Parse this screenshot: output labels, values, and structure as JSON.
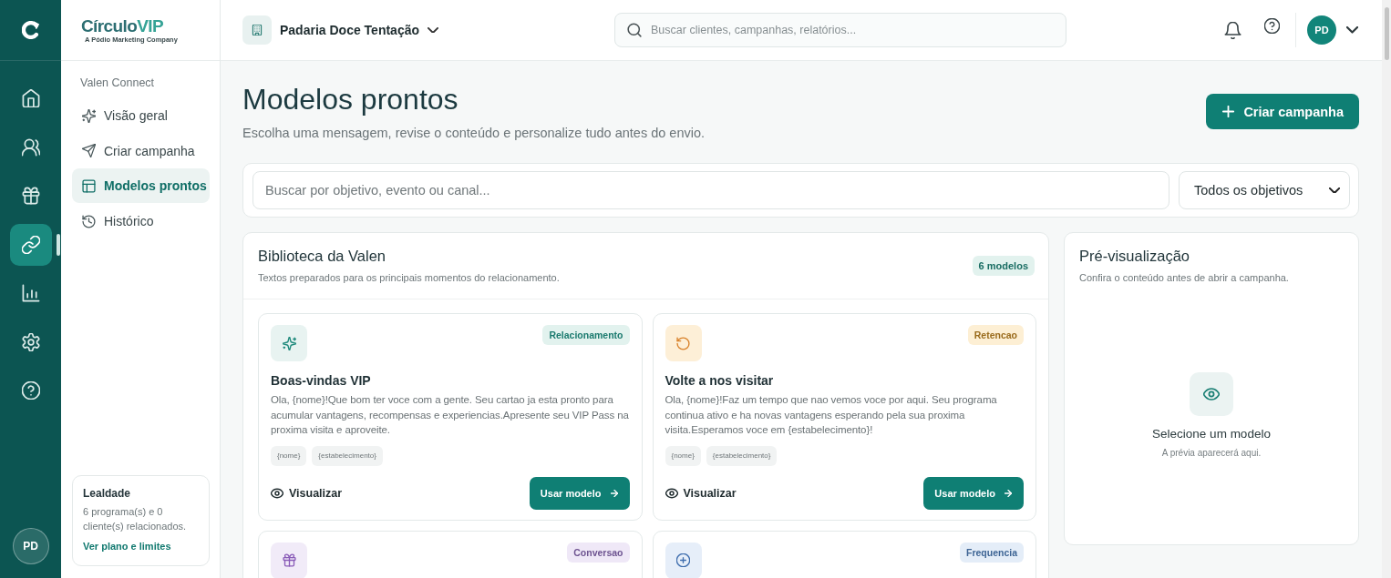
{
  "rail": {
    "items": [
      {
        "kind": "home",
        "selected": false
      },
      {
        "kind": "customers",
        "selected": false
      },
      {
        "kind": "rewards",
        "selected": false
      },
      {
        "kind": "connect",
        "selected": true
      },
      {
        "kind": "reports",
        "selected": false
      },
      {
        "kind": "settings",
        "selected": false
      },
      {
        "kind": "help",
        "selected": false
      }
    ],
    "avatar": "PD"
  },
  "brand": {
    "name": "Círculo",
    "accent": "VIP",
    "tagline": "A Pódio Marketing Company"
  },
  "sidebar": {
    "section": "Valen Connect",
    "items": [
      {
        "label": "Visão geral",
        "kind": "overview",
        "selected": false
      },
      {
        "label": "Criar campanha",
        "kind": "create",
        "selected": false
      },
      {
        "label": "Modelos prontos",
        "kind": "templates",
        "selected": true
      },
      {
        "label": "Histórico",
        "kind": "history",
        "selected": false
      }
    ],
    "plan_card": {
      "title": "Lealdade",
      "text": "6 programa(s) e 0 cliente(s) relacionados.",
      "link": "Ver plano e limites"
    }
  },
  "topbar": {
    "business": "Padaria Doce Tentação",
    "search": {
      "placeholder": "Buscar clientes, campanhas, relatórios..."
    },
    "avatar": "PD"
  },
  "page": {
    "title": "Modelos prontos",
    "subtitle": "Escolha uma mensagem, revise o conteúdo e personalize tudo antes do envio.",
    "primary_button": "Criar campanha"
  },
  "filters": {
    "search": {
      "placeholder": "Buscar por objetivo, evento ou canal..."
    },
    "objective": {
      "value": "Todos os objetivos"
    }
  },
  "library": {
    "title": "Biblioteca da Valen",
    "subtitle": "Textos preparados para os principais momentos do relacionamento.",
    "count": "6 modelos",
    "templates": [
      {
        "kind": "relationship",
        "tag": "Relacionamento",
        "color": "#1a7a6e",
        "title": "Boas-vindas VIP",
        "body": "Ola, {nome}!Que bom ter voce com a gente. Seu cartao ja esta pronto para acumular vantagens, recompensas e experiencias.Apresente seu VIP Pass na proxima visita e aproveite.",
        "variables": [
          "{nome}",
          "{estabelecimento}"
        ],
        "preview_button": "Visualizar",
        "use_button": "Usar modelo"
      },
      {
        "kind": "retention",
        "tag": "Retencao",
        "color": "#9a6b1c",
        "title": "Volte a nos visitar",
        "body": "Ola, {nome}!Faz um tempo que nao vemos voce por aqui. Seu programa continua ativo e ha novas vantagens esperando pela sua proxima visita.Esperamos voce em {estabelecimento}!",
        "variables": [
          "{nome}",
          "{estabelecimento}"
        ],
        "preview_button": "Visualizar",
        "use_button": "Usar modelo"
      },
      {
        "kind": "conversion",
        "tag": "Conversao",
        "color": "#6e5491"
      },
      {
        "kind": "frequency",
        "tag": "Frequencia",
        "color": "#3d6494"
      }
    ]
  },
  "preview": {
    "title": "Pré-visualização",
    "subtitle": "Confira o conteúdo antes de abrir a campanha.",
    "empty_title": "Selecione um modelo",
    "empty_text": "A prévia aparecerá aqui."
  }
}
